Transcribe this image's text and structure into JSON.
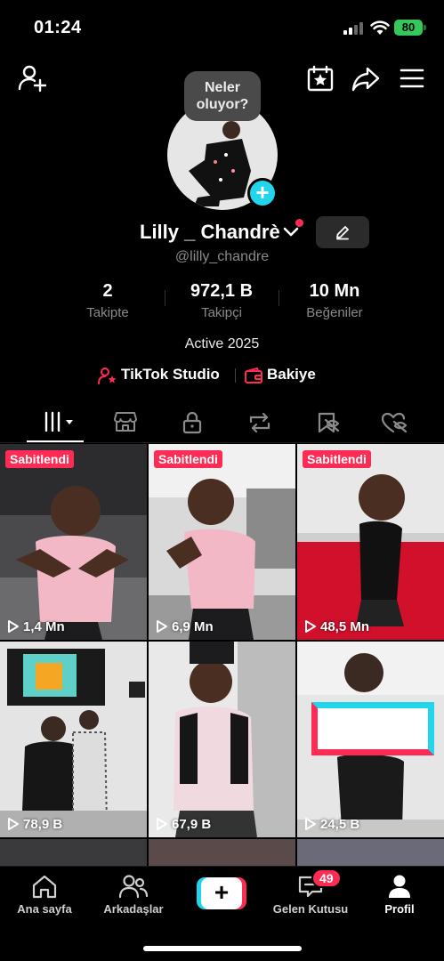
{
  "status_bar": {
    "time": "01:24",
    "battery": "80"
  },
  "profile": {
    "story_bubble": "Neler oluyor?",
    "display_name": "Lilly _ Chandrè",
    "username": "@lilly_chandre",
    "stats": [
      {
        "value": "2",
        "label": "Takipte"
      },
      {
        "value": "972,1 B",
        "label": "Takipçi"
      },
      {
        "value": "10 Mn",
        "label": "Beğeniler"
      }
    ],
    "bio": "Active 2025",
    "links": {
      "studio": "TikTok Studio",
      "wallet": "Bakiye"
    }
  },
  "tabs": [
    "videos-grid-icon",
    "shop-icon",
    "lock-icon",
    "repost-icon",
    "saved-hidden-icon",
    "liked-hidden-icon"
  ],
  "videos": [
    {
      "pinned": "Sabitlendi",
      "views": "1,4 Mn"
    },
    {
      "pinned": "Sabitlendi",
      "views": "6,9 Mn"
    },
    {
      "pinned": "Sabitlendi",
      "views": "48,5 Mn"
    },
    {
      "views": "78,9 B"
    },
    {
      "views": "67,9 B"
    },
    {
      "views": "24,5 B"
    }
  ],
  "nav": {
    "home": "Ana sayfa",
    "friends": "Arkadaşlar",
    "create": "+",
    "inbox": "Gelen Kutusu",
    "inbox_badge": "49",
    "profile": "Profil"
  },
  "colors": {
    "accent_red": "#fe2c55",
    "accent_cyan": "#20d5ec",
    "battery": "#34c759"
  }
}
